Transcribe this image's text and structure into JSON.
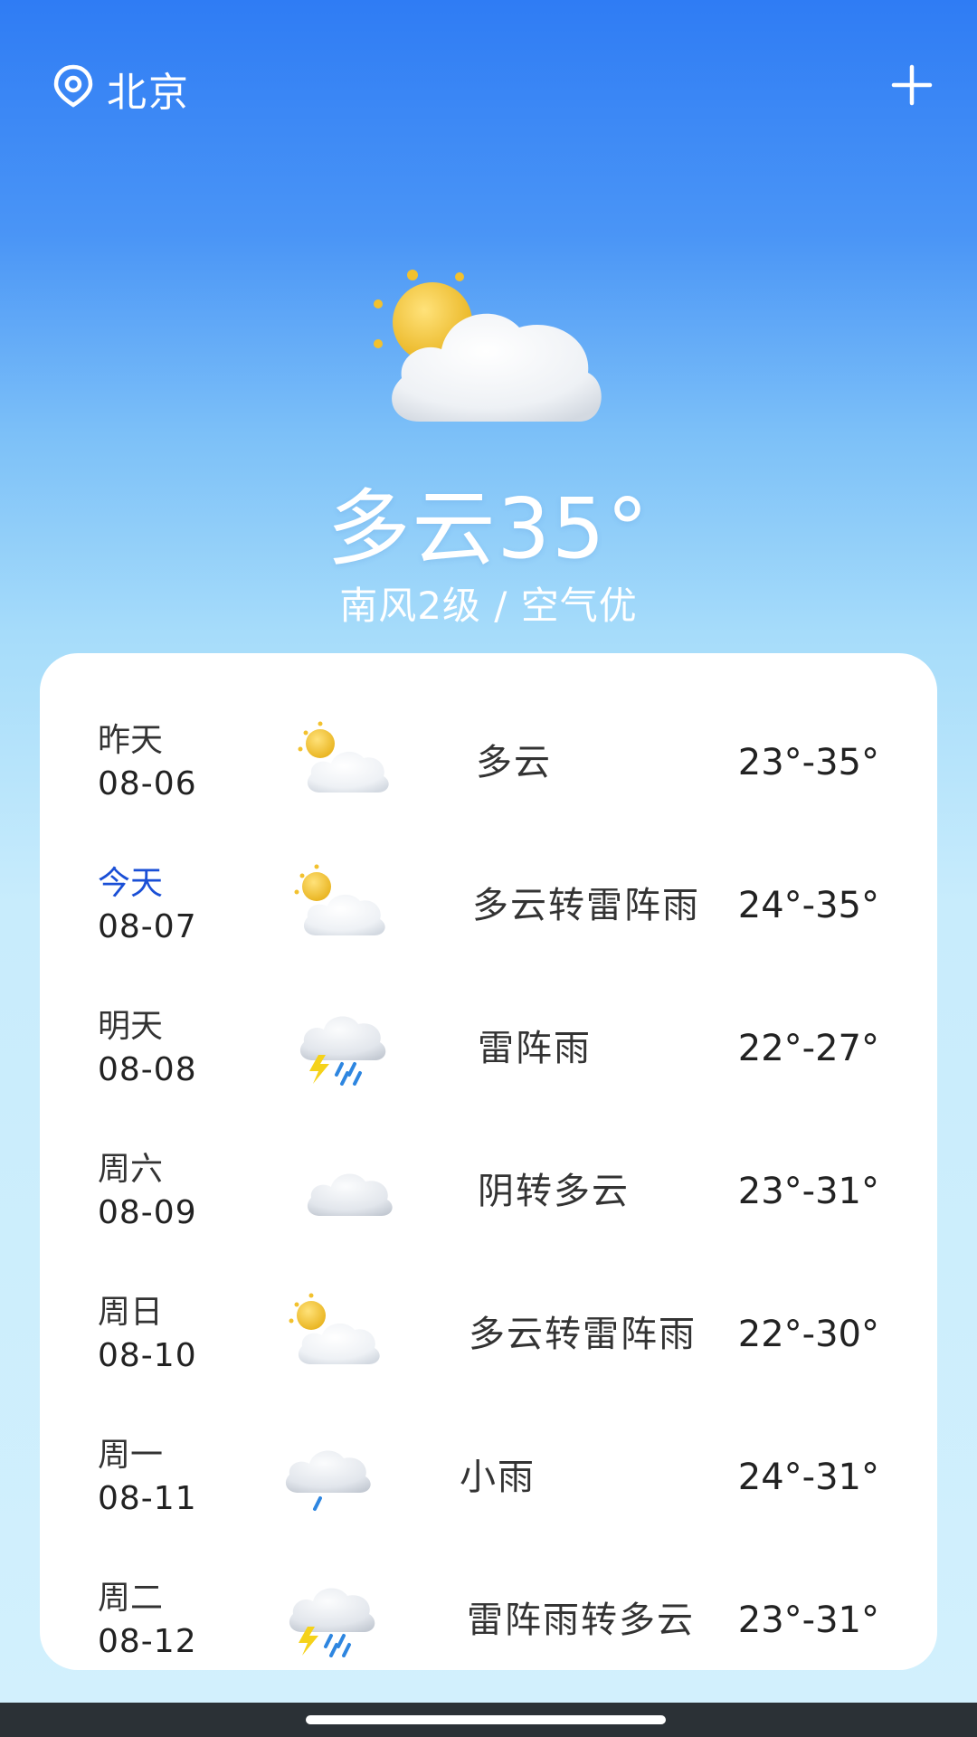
{
  "header": {
    "location_icon": "location-pin-icon",
    "city": "北京",
    "add_icon": "plus-icon"
  },
  "current": {
    "icon": "partly-cloudy-icon",
    "condition_temp": "多云35°",
    "details": "南风2级 / 空气优"
  },
  "forecast": [
    {
      "day": "昨天",
      "date": "08-06",
      "icon": "partly-cloudy-icon",
      "condition": "多云",
      "range": "23°-35°",
      "highlight": false
    },
    {
      "day": "今天",
      "date": "08-07",
      "icon": "partly-cloudy-icon",
      "condition": "多云转雷阵雨",
      "range": "24°-35°",
      "highlight": true
    },
    {
      "day": "明天",
      "date": "08-08",
      "icon": "thunderstorm-icon",
      "condition": "雷阵雨",
      "range": "22°-27°",
      "highlight": false
    },
    {
      "day": "周六",
      "date": "08-09",
      "icon": "cloudy-icon",
      "condition": "阴转多云",
      "range": "23°-31°",
      "highlight": false
    },
    {
      "day": "周日",
      "date": "08-10",
      "icon": "partly-cloudy-icon",
      "condition": "多云转雷阵雨",
      "range": "22°-30°",
      "highlight": false
    },
    {
      "day": "周一",
      "date": "08-11",
      "icon": "light-rain-icon",
      "condition": "小雨",
      "range": "24°-31°",
      "highlight": false
    },
    {
      "day": "周二",
      "date": "08-12",
      "icon": "thunderstorm-icon",
      "condition": "雷阵雨转多云",
      "range": "23°-31°",
      "highlight": false
    }
  ],
  "colors": {
    "sky_top": "#2f7cf4",
    "sky_bottom": "#d2f0fd",
    "today_label": "#1a4fd6",
    "sun": "#f2c12e",
    "rain": "#2e86e0",
    "bolt": "#f5d21a"
  }
}
